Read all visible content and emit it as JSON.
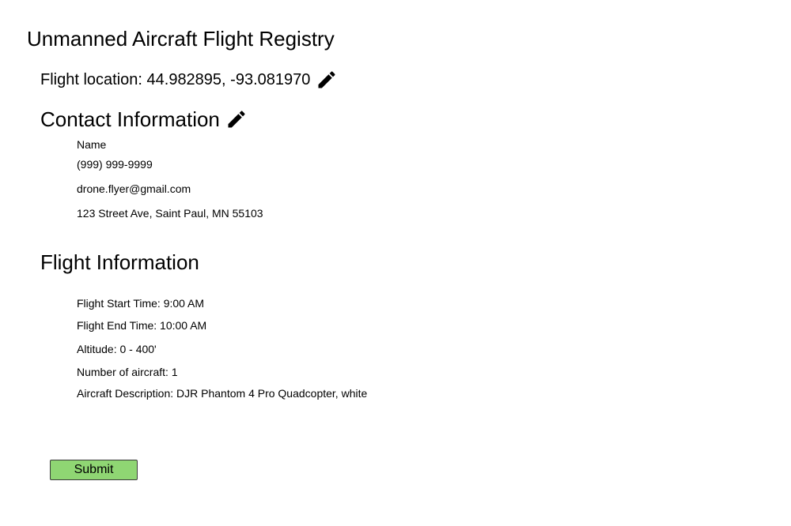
{
  "page": {
    "title": "Unmanned Aircraft Flight Registry"
  },
  "location": {
    "label": "Flight location: 44.982895, -93.081970",
    "edit_icon": "pencil-icon"
  },
  "contact": {
    "heading": "Contact Information",
    "edit_icon": "pencil-icon",
    "name": "Name",
    "phone": "(999) 999-9999",
    "email": "drone.flyer@gmail.com",
    "address": "123 Street Ave, Saint Paul, MN 55103"
  },
  "flight": {
    "heading": "Flight Information",
    "start_time": "Flight Start Time: 9:00 AM",
    "end_time": "Flight End Time: 10:00 AM",
    "altitude": "Altitude: 0 - 400'",
    "aircraft_count": "Number of aircraft: 1",
    "aircraft_description": "Aircraft Description: DJR Phantom 4 Pro Quadcopter, white"
  },
  "actions": {
    "submit_label": "Submit",
    "submit_color": "#8fd673"
  }
}
